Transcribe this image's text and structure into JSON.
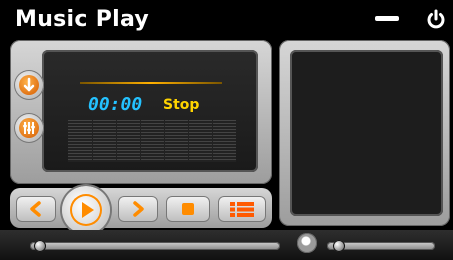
{
  "window": {
    "title": "Music Play"
  },
  "player": {
    "time": "00:00",
    "status": "Stop"
  },
  "colors": {
    "accent": "#ff8c00",
    "time": "#24c2ff",
    "status": "#ffd400"
  },
  "controls": {
    "icons": [
      "download-icon",
      "equalizer-icon",
      "previous-icon",
      "play-icon",
      "next-icon",
      "stop-icon",
      "playlist-icon",
      "minimize-icon",
      "power-icon",
      "volume-icon"
    ]
  }
}
